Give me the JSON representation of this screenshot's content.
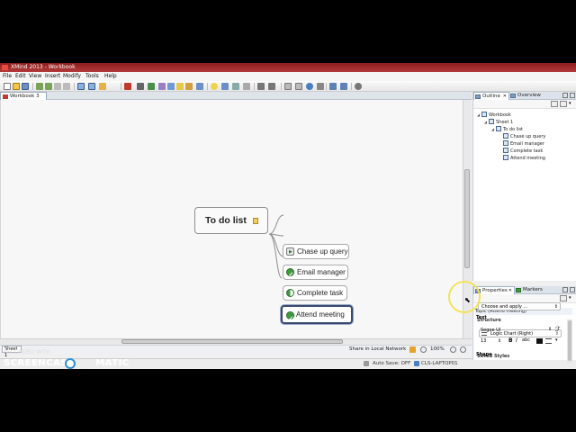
{
  "window": {
    "title": "XMind 2013 - Workbook"
  },
  "menu": [
    "File",
    "Edit",
    "View",
    "Insert",
    "Modify",
    "Tools",
    "Help"
  ],
  "editor": {
    "tab_label": "Workbook 3"
  },
  "map": {
    "central": "To do list",
    "topics": [
      {
        "label": "Chase up query",
        "status": "in-progress"
      },
      {
        "label": "Email manager",
        "status": "done"
      },
      {
        "label": "Complete task",
        "status": "half"
      },
      {
        "label": "Attend meeting",
        "status": "done"
      }
    ]
  },
  "sheet": {
    "tab_label": "Sheet 1"
  },
  "status": {
    "share": "Share in Local Network",
    "zoom": "100%",
    "autosave": "Auto Save: OFF",
    "computer": "CLS-LAPTOP01"
  },
  "outline": {
    "tabs": [
      "Outline",
      "Overview"
    ],
    "tree": [
      {
        "label": "Workbook",
        "level": 0
      },
      {
        "label": "Sheet 1",
        "level": 1
      },
      {
        "label": "To do list",
        "level": 2
      },
      {
        "label": "Chase up query",
        "level": 3
      },
      {
        "label": "Email manager",
        "level": 3
      },
      {
        "label": "Complete task",
        "level": 3
      },
      {
        "label": "Attend meeting",
        "level": 3
      }
    ]
  },
  "properties": {
    "tabs": [
      "Properties",
      "Markers"
    ],
    "selection": "Topic (Attend meeting)",
    "structure_heading": "Structure",
    "structure_value": "Logic Chart (Right)",
    "styles_heading": "Saved Styles",
    "styles_value": "Choose and apply ...",
    "text_heading": "Text",
    "font_value": "Segoe UI",
    "font_size": "13",
    "shape_heading": "Shape"
  },
  "watermark": {
    "recorded": "RECORDED WITH",
    "brand_left": "SCREENCAST",
    "brand_right": "MATIC"
  },
  "colors": {
    "titlebar": "#8e1d1d",
    "done_marker": "#3c9b3c",
    "selection_border": "#3a4a6e",
    "cursor_highlight": "#f3e25a"
  }
}
